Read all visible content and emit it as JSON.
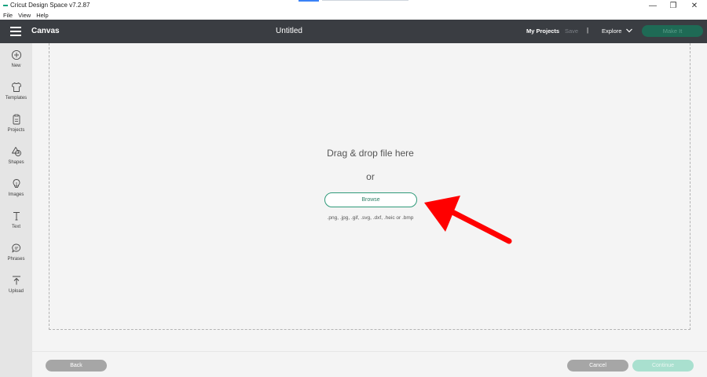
{
  "window": {
    "title": "Cricut Design Space  v7.2.87",
    "minimize_glyph": "—",
    "maximize_glyph": "❐",
    "close_glyph": "✕"
  },
  "menubar": {
    "items": [
      "File",
      "View",
      "Help"
    ]
  },
  "header": {
    "section": "Canvas",
    "document_title": "Untitled",
    "my_projects": "My Projects",
    "save": "Save",
    "separator": "|",
    "explore": "Explore",
    "make_it": "Make It"
  },
  "sidebar": {
    "items": [
      {
        "label": "New",
        "icon": "plus-circle-icon"
      },
      {
        "label": "Templates",
        "icon": "shirt-icon"
      },
      {
        "label": "Projects",
        "icon": "clipboard-icon"
      },
      {
        "label": "Shapes",
        "icon": "shapes-icon"
      },
      {
        "label": "Images",
        "icon": "lightbulb-icon"
      },
      {
        "label": "Text",
        "icon": "text-icon"
      },
      {
        "label": "Phrases",
        "icon": "speech-bubble-icon"
      },
      {
        "label": "Upload",
        "icon": "upload-icon"
      }
    ]
  },
  "upload": {
    "heading": "Drag & drop file here",
    "or": "or",
    "browse": "Browse",
    "formats": ".png, .jpg, .gif, .svg, .dxf, .heic or .bmp"
  },
  "footer": {
    "back": "Back",
    "cancel": "Cancel",
    "continue": "Continue"
  },
  "colors": {
    "header_bg": "#3a3d42",
    "accent": "#2f9a7a",
    "annotation": "#ff0000"
  }
}
